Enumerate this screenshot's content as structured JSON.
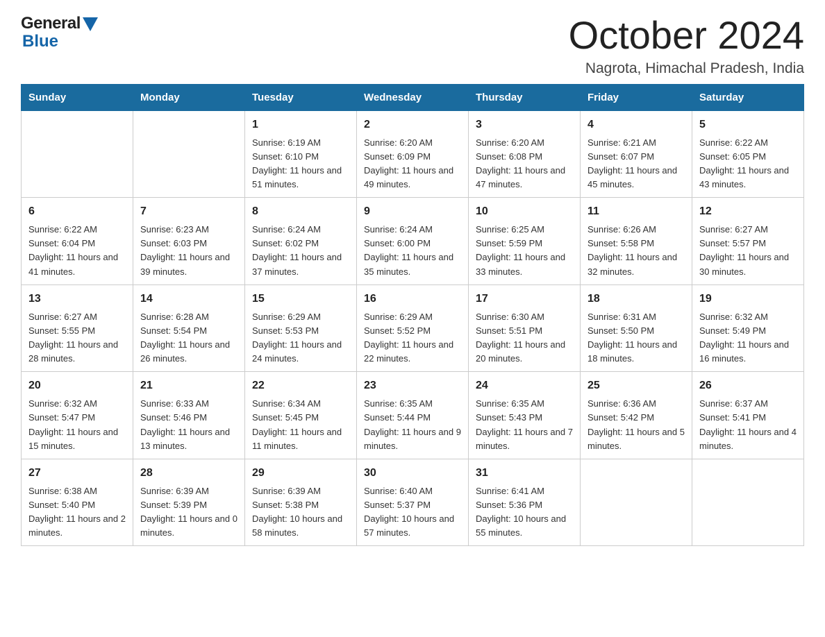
{
  "logo": {
    "general": "General",
    "blue": "Blue"
  },
  "title": {
    "month_year": "October 2024",
    "location": "Nagrota, Himachal Pradesh, India"
  },
  "days_of_week": [
    "Sunday",
    "Monday",
    "Tuesday",
    "Wednesday",
    "Thursday",
    "Friday",
    "Saturday"
  ],
  "weeks": [
    [
      {
        "day": "",
        "sunrise": "",
        "sunset": "",
        "daylight": ""
      },
      {
        "day": "",
        "sunrise": "",
        "sunset": "",
        "daylight": ""
      },
      {
        "day": "1",
        "sunrise": "Sunrise: 6:19 AM",
        "sunset": "Sunset: 6:10 PM",
        "daylight": "Daylight: 11 hours and 51 minutes."
      },
      {
        "day": "2",
        "sunrise": "Sunrise: 6:20 AM",
        "sunset": "Sunset: 6:09 PM",
        "daylight": "Daylight: 11 hours and 49 minutes."
      },
      {
        "day": "3",
        "sunrise": "Sunrise: 6:20 AM",
        "sunset": "Sunset: 6:08 PM",
        "daylight": "Daylight: 11 hours and 47 minutes."
      },
      {
        "day": "4",
        "sunrise": "Sunrise: 6:21 AM",
        "sunset": "Sunset: 6:07 PM",
        "daylight": "Daylight: 11 hours and 45 minutes."
      },
      {
        "day": "5",
        "sunrise": "Sunrise: 6:22 AM",
        "sunset": "Sunset: 6:05 PM",
        "daylight": "Daylight: 11 hours and 43 minutes."
      }
    ],
    [
      {
        "day": "6",
        "sunrise": "Sunrise: 6:22 AM",
        "sunset": "Sunset: 6:04 PM",
        "daylight": "Daylight: 11 hours and 41 minutes."
      },
      {
        "day": "7",
        "sunrise": "Sunrise: 6:23 AM",
        "sunset": "Sunset: 6:03 PM",
        "daylight": "Daylight: 11 hours and 39 minutes."
      },
      {
        "day": "8",
        "sunrise": "Sunrise: 6:24 AM",
        "sunset": "Sunset: 6:02 PM",
        "daylight": "Daylight: 11 hours and 37 minutes."
      },
      {
        "day": "9",
        "sunrise": "Sunrise: 6:24 AM",
        "sunset": "Sunset: 6:00 PM",
        "daylight": "Daylight: 11 hours and 35 minutes."
      },
      {
        "day": "10",
        "sunrise": "Sunrise: 6:25 AM",
        "sunset": "Sunset: 5:59 PM",
        "daylight": "Daylight: 11 hours and 33 minutes."
      },
      {
        "day": "11",
        "sunrise": "Sunrise: 6:26 AM",
        "sunset": "Sunset: 5:58 PM",
        "daylight": "Daylight: 11 hours and 32 minutes."
      },
      {
        "day": "12",
        "sunrise": "Sunrise: 6:27 AM",
        "sunset": "Sunset: 5:57 PM",
        "daylight": "Daylight: 11 hours and 30 minutes."
      }
    ],
    [
      {
        "day": "13",
        "sunrise": "Sunrise: 6:27 AM",
        "sunset": "Sunset: 5:55 PM",
        "daylight": "Daylight: 11 hours and 28 minutes."
      },
      {
        "day": "14",
        "sunrise": "Sunrise: 6:28 AM",
        "sunset": "Sunset: 5:54 PM",
        "daylight": "Daylight: 11 hours and 26 minutes."
      },
      {
        "day": "15",
        "sunrise": "Sunrise: 6:29 AM",
        "sunset": "Sunset: 5:53 PM",
        "daylight": "Daylight: 11 hours and 24 minutes."
      },
      {
        "day": "16",
        "sunrise": "Sunrise: 6:29 AM",
        "sunset": "Sunset: 5:52 PM",
        "daylight": "Daylight: 11 hours and 22 minutes."
      },
      {
        "day": "17",
        "sunrise": "Sunrise: 6:30 AM",
        "sunset": "Sunset: 5:51 PM",
        "daylight": "Daylight: 11 hours and 20 minutes."
      },
      {
        "day": "18",
        "sunrise": "Sunrise: 6:31 AM",
        "sunset": "Sunset: 5:50 PM",
        "daylight": "Daylight: 11 hours and 18 minutes."
      },
      {
        "day": "19",
        "sunrise": "Sunrise: 6:32 AM",
        "sunset": "Sunset: 5:49 PM",
        "daylight": "Daylight: 11 hours and 16 minutes."
      }
    ],
    [
      {
        "day": "20",
        "sunrise": "Sunrise: 6:32 AM",
        "sunset": "Sunset: 5:47 PM",
        "daylight": "Daylight: 11 hours and 15 minutes."
      },
      {
        "day": "21",
        "sunrise": "Sunrise: 6:33 AM",
        "sunset": "Sunset: 5:46 PM",
        "daylight": "Daylight: 11 hours and 13 minutes."
      },
      {
        "day": "22",
        "sunrise": "Sunrise: 6:34 AM",
        "sunset": "Sunset: 5:45 PM",
        "daylight": "Daylight: 11 hours and 11 minutes."
      },
      {
        "day": "23",
        "sunrise": "Sunrise: 6:35 AM",
        "sunset": "Sunset: 5:44 PM",
        "daylight": "Daylight: 11 hours and 9 minutes."
      },
      {
        "day": "24",
        "sunrise": "Sunrise: 6:35 AM",
        "sunset": "Sunset: 5:43 PM",
        "daylight": "Daylight: 11 hours and 7 minutes."
      },
      {
        "day": "25",
        "sunrise": "Sunrise: 6:36 AM",
        "sunset": "Sunset: 5:42 PM",
        "daylight": "Daylight: 11 hours and 5 minutes."
      },
      {
        "day": "26",
        "sunrise": "Sunrise: 6:37 AM",
        "sunset": "Sunset: 5:41 PM",
        "daylight": "Daylight: 11 hours and 4 minutes."
      }
    ],
    [
      {
        "day": "27",
        "sunrise": "Sunrise: 6:38 AM",
        "sunset": "Sunset: 5:40 PM",
        "daylight": "Daylight: 11 hours and 2 minutes."
      },
      {
        "day": "28",
        "sunrise": "Sunrise: 6:39 AM",
        "sunset": "Sunset: 5:39 PM",
        "daylight": "Daylight: 11 hours and 0 minutes."
      },
      {
        "day": "29",
        "sunrise": "Sunrise: 6:39 AM",
        "sunset": "Sunset: 5:38 PM",
        "daylight": "Daylight: 10 hours and 58 minutes."
      },
      {
        "day": "30",
        "sunrise": "Sunrise: 6:40 AM",
        "sunset": "Sunset: 5:37 PM",
        "daylight": "Daylight: 10 hours and 57 minutes."
      },
      {
        "day": "31",
        "sunrise": "Sunrise: 6:41 AM",
        "sunset": "Sunset: 5:36 PM",
        "daylight": "Daylight: 10 hours and 55 minutes."
      },
      {
        "day": "",
        "sunrise": "",
        "sunset": "",
        "daylight": ""
      },
      {
        "day": "",
        "sunrise": "",
        "sunset": "",
        "daylight": ""
      }
    ]
  ]
}
